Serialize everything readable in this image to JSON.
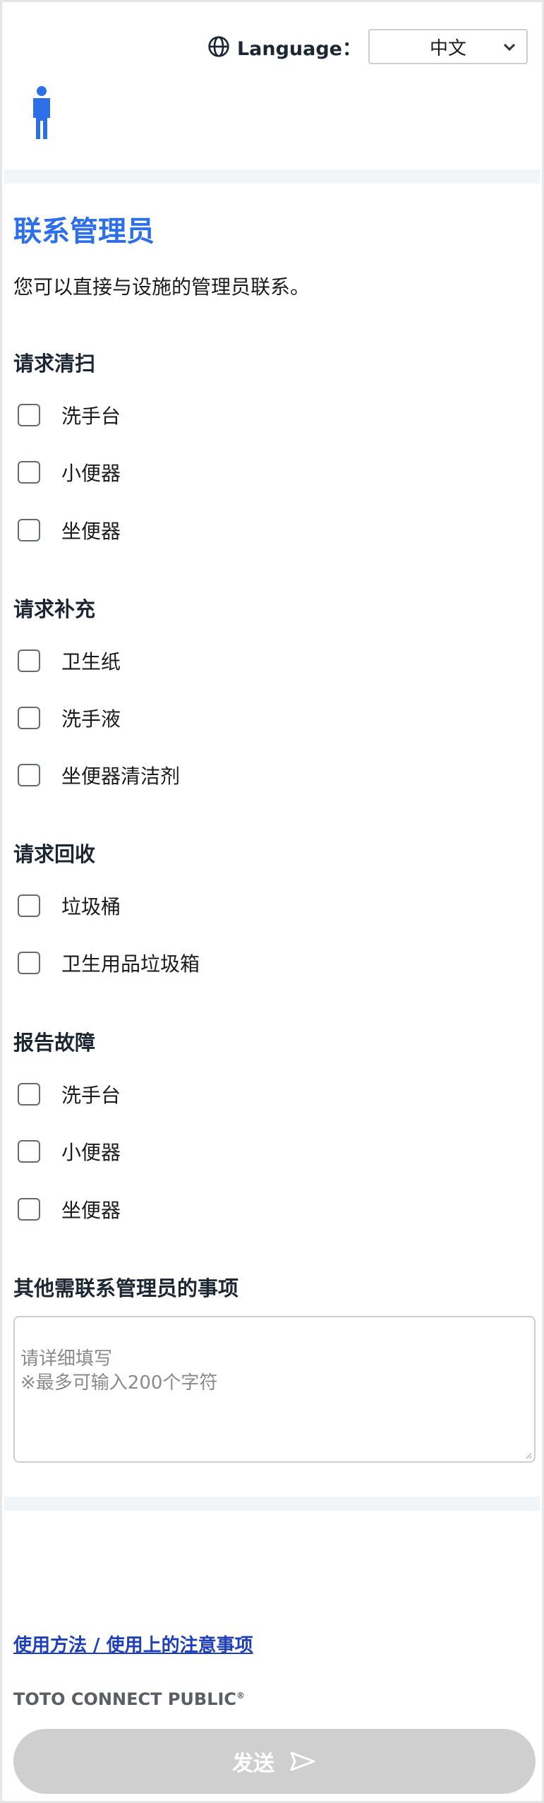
{
  "header": {
    "language_label": "Language：",
    "language_value": "中文"
  },
  "title": "联系管理员",
  "description": "您可以直接与设施的管理员联系。",
  "sections": [
    {
      "title": "请求清扫",
      "items": [
        "洗手台",
        "小便器",
        "坐便器"
      ]
    },
    {
      "title": "请求补充",
      "items": [
        "卫生纸",
        "洗手液",
        "坐便器清洁剂"
      ]
    },
    {
      "title": "请求回收",
      "items": [
        "垃圾桶",
        "卫生用品垃圾箱"
      ]
    },
    {
      "title": "报告故障",
      "items": [
        "洗手台",
        "小便器",
        "坐便器"
      ]
    }
  ],
  "notes": {
    "title": "其他需联系管理员的事项",
    "placeholder": "请详细填写\n※最多可输入200个字符"
  },
  "footer": {
    "usage_link": "使用方法 / 使用上的注意事项",
    "brand": "TOTO CONNECT PUBLIC",
    "brand_mark": "®",
    "send_label": "发送"
  },
  "colors": {
    "accent": "#2d6fe6",
    "link": "#1e3fb8",
    "send_disabled": "#cfcfcf"
  },
  "icons": [
    "globe-icon",
    "chevron-down-icon",
    "person-icon",
    "send-icon"
  ]
}
